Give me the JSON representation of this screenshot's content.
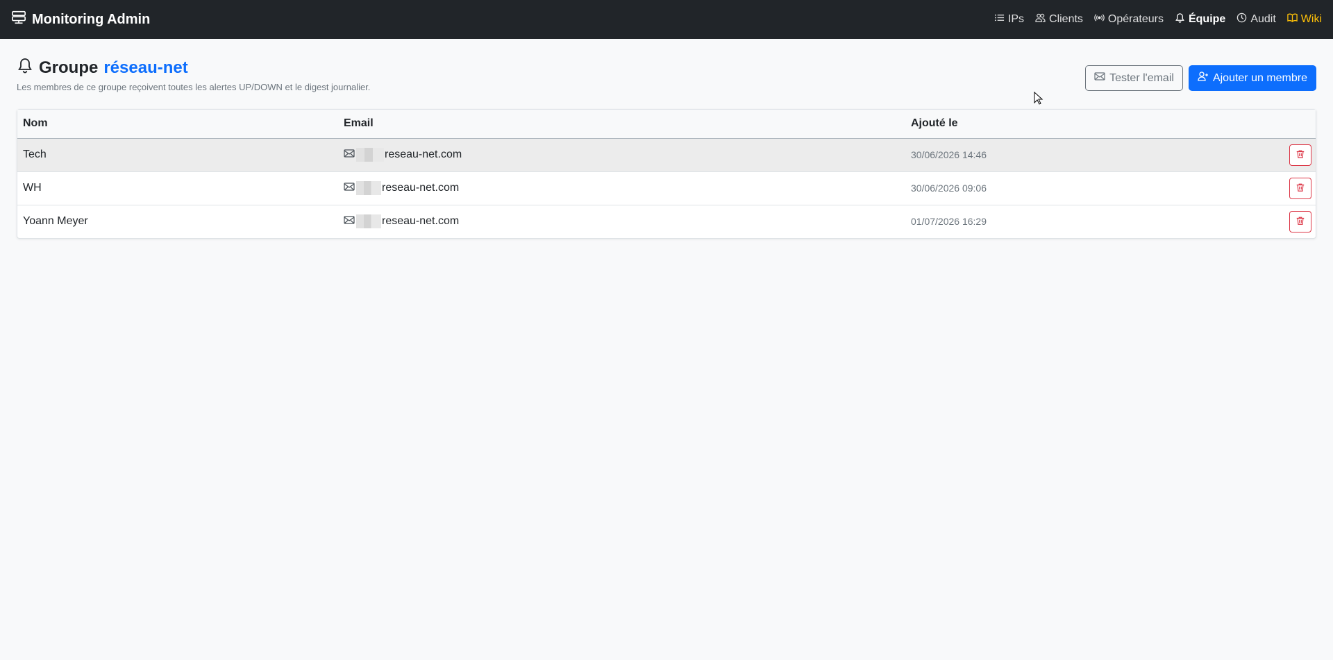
{
  "app": {
    "title": "Monitoring Admin"
  },
  "nav": {
    "ips": "IPs",
    "clients": "Clients",
    "operators": "Opérateurs",
    "team": "Équipe",
    "audit": "Audit",
    "wiki": "Wiki"
  },
  "page": {
    "title_prefix": "Groupe",
    "group_name": "réseau-net",
    "subtitle": "Les membres de ce groupe reçoivent toutes les alertes UP/DOWN et le digest journalier."
  },
  "actions": {
    "test_email": "Tester l'email",
    "add_member": "Ajouter un membre"
  },
  "table": {
    "columns": [
      "Nom",
      "Email",
      "Ajouté le"
    ],
    "rows": [
      {
        "name": "Tech",
        "email_domain": "reseau-net.com",
        "added": "30/06/2026 14:46"
      },
      {
        "name": "WH",
        "email_domain": "reseau-net.com",
        "added": "30/06/2026 09:06"
      },
      {
        "name": "Yoann Meyer",
        "email_domain": "reseau-net.com",
        "added": "01/07/2026 16:29"
      }
    ]
  },
  "colors": {
    "navbar": "#212529",
    "accent": "#0d6efd",
    "wiki": "#ffc107",
    "danger": "#dc3545"
  }
}
